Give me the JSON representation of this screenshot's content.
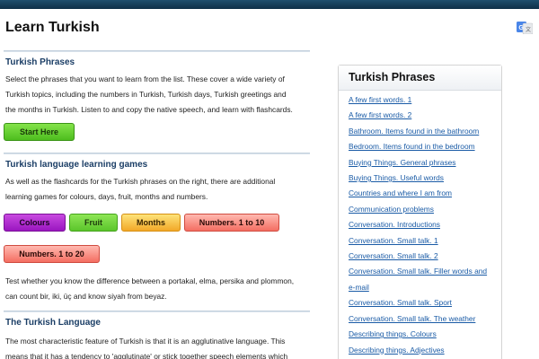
{
  "page": {
    "title": "Learn Turkish"
  },
  "sections": {
    "phrases": {
      "heading": "Turkish Phrases",
      "text_lines": [
        "Select the phrases that you want to learn from the list. These cover a wide variety of",
        "Turkish topics, including the numbers in Turkish, Turkish days, Turkish greetings and",
        "the months in Turkish. Listen to and copy the native speech, and learn with flashcards."
      ],
      "start_button": "Start Here"
    },
    "games": {
      "heading": "Turkish language learning games",
      "text_lines": [
        "As well as the flashcards for the Turkish phrases on the right, there are additional",
        "learning games for colours, days, fruit, months and numbers."
      ],
      "buttons": [
        "Colours",
        "Fruit",
        "Months",
        "Numbers. 1 to 10",
        "Numbers. 1 to 20"
      ],
      "after_lines": [
        "Test whether you know the difference between a portakal, elma, persika and plommon,",
        "can count bir, iki, üç and know siyah from beyaz."
      ]
    },
    "language": {
      "heading": "The Turkish Language",
      "text_lines": [
        "The most characteristic feature of Turkish is that it is an agglutinative language. This",
        "means that it has a tendency to 'agglutinate' or stick together speech elements which"
      ]
    }
  },
  "sidebar": {
    "title": "Turkish Phrases",
    "items": [
      "A few first words. 1",
      "A few first words. 2",
      "Bathroom. Items found in the bathroom",
      "Bedroom. Items found in the bedroom",
      "Buying Things. General phrases",
      "Buying Things. Useful words",
      "Countries and where I am from",
      "Communication problems",
      "Conversation. Introductions",
      "Conversation. Small talk. 1",
      "Conversation. Small talk. 2",
      "Conversation. Small talk. Filler words and",
      "e-mail",
      "Conversation. Small talk. Sport",
      "Conversation. Small talk. The weather",
      "Describing things. Colours",
      "Describing things. Adjectives"
    ]
  },
  "colors": {
    "topbar": "#0e2f47",
    "heading": "#1b3e66",
    "link": "#1a5ba6"
  },
  "icons": {
    "translate": "google-translate-icon"
  }
}
